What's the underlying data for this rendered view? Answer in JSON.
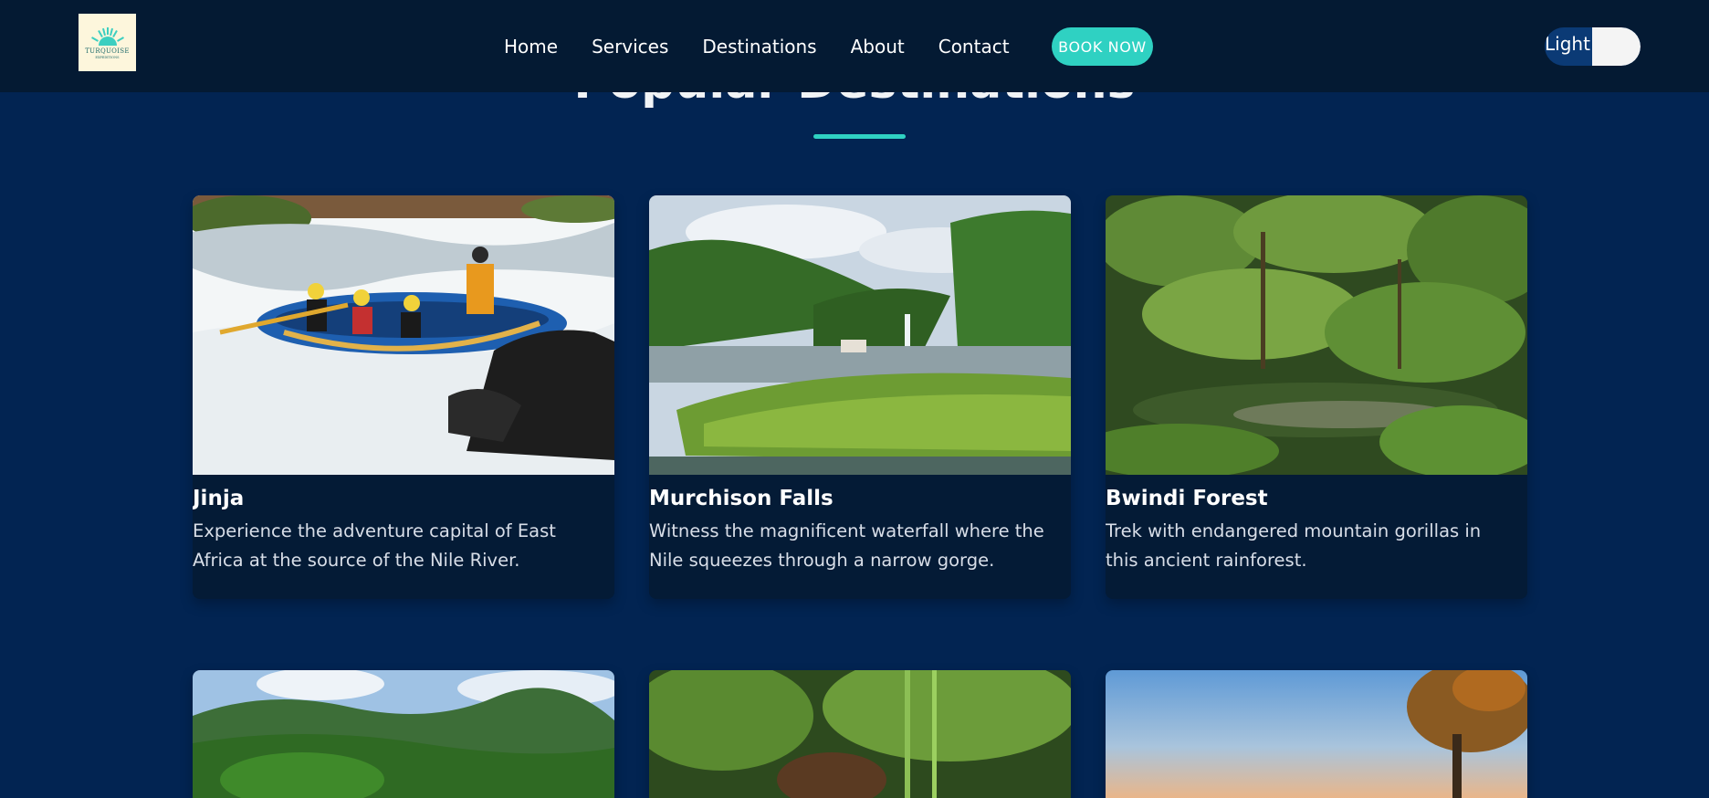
{
  "logo": {
    "text": "TURQUOISE",
    "subtext": "EXPEDITIONS"
  },
  "nav": {
    "items": [
      "Home",
      "Services",
      "Destinations",
      "About",
      "Contact"
    ],
    "cta_label": "BOOK NOW",
    "theme_toggle_label": "Light"
  },
  "section": {
    "title": "Popular Destinations"
  },
  "destinations": [
    {
      "title": "Jinja",
      "description": "Experience the adventure capital of East Africa at the source of the Nile River."
    },
    {
      "title": "Murchison Falls",
      "description": "Witness the magnificent waterfall where the Nile squeezes through a narrow gorge."
    },
    {
      "title": "Bwindi Forest",
      "description": "Trek with endangered mountain gorillas in this ancient rainforest."
    }
  ],
  "colors": {
    "background": "#022452",
    "header": "#041a33",
    "accent": "#2fd1c2",
    "card": "#041b36"
  }
}
